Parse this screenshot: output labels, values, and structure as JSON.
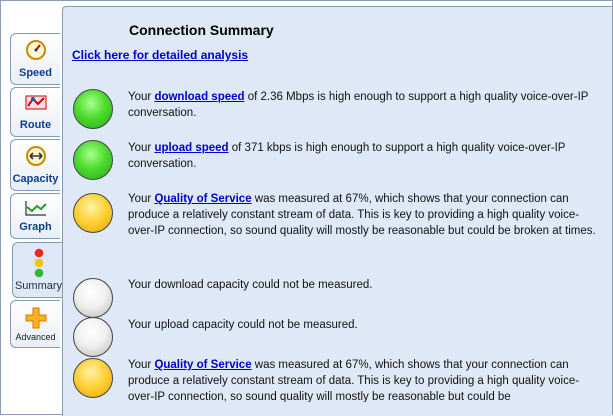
{
  "tabs": [
    {
      "label": "Speed",
      "icon": "speedometer-icon"
    },
    {
      "label": "Route",
      "icon": "route-icon"
    },
    {
      "label": "Capacity",
      "icon": "capacity-icon"
    },
    {
      "label": "Graph",
      "icon": "graph-icon"
    },
    {
      "label": "Summary",
      "icon": "traffic-light-icon"
    },
    {
      "label": "Advanced",
      "icon": "plus-icon"
    }
  ],
  "active_tab": "Summary",
  "panel": {
    "title": "Connection Summary",
    "detail_link": "Click here for detailed analysis",
    "items": [
      {
        "status": "green",
        "prefix": "Your ",
        "link": "download speed",
        "suffix": " of 2.36 Mbps is high enough to support a high quality voice-over-IP conversation."
      },
      {
        "status": "green",
        "prefix": "Your ",
        "link": "upload speed",
        "suffix": " of 371 kbps is high enough to support a high quality voice-over-IP conversation."
      },
      {
        "status": "yellow",
        "prefix": "Your ",
        "link": "Quality of Service",
        "suffix": " was measured at 67%, which shows that your connection can produce a relatively constant stream of data. This is key to providing a high quality voice-over-IP connection, so sound quality will mostly be reasonable but could be broken at times."
      },
      {
        "status": "gray",
        "text": "Your download capacity could not be measured."
      },
      {
        "status": "gray",
        "text": "Your upload capacity could not be measured."
      },
      {
        "status": "yellow",
        "prefix": "Your ",
        "link": "Quality of Service",
        "suffix": " was measured at 67%, which shows that your connection can produce a relatively constant stream of data. This is key to providing a high quality voice-over-IP connection, so sound quality will mostly be reasonable but could be"
      }
    ]
  },
  "colors": {
    "panel_bg": "#dfe8f6",
    "link": "#0000cc",
    "tab_label": "#0b3d91"
  }
}
